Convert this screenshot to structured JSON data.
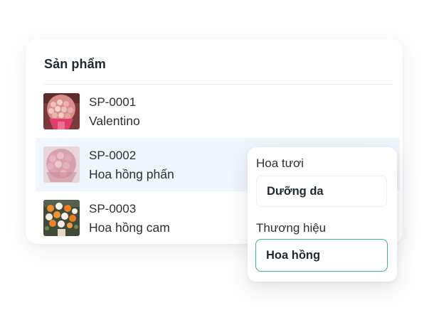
{
  "products_panel": {
    "title": "Sản phẩm",
    "rows": [
      {
        "code": "SP-0001",
        "name": "Valentino",
        "image": "valentino-bouquet-image",
        "selected": false
      },
      {
        "code": "SP-0002",
        "name": "Hoa hồng phấn",
        "image": "pink-rose-bouquet-image",
        "selected": true
      },
      {
        "code": "SP-0003",
        "name": "Hoa hồng cam",
        "image": "orange-rose-stand-image",
        "selected": false
      }
    ]
  },
  "filter_popup": {
    "group_label": "Hoa tươi",
    "group_value": "Dưỡng da",
    "brand_label": "Thương hiệu",
    "brand_value": "Hoa hồng"
  },
  "colors": {
    "accent_border": "#3bb58f",
    "row_highlight": "#f0f6fd"
  }
}
